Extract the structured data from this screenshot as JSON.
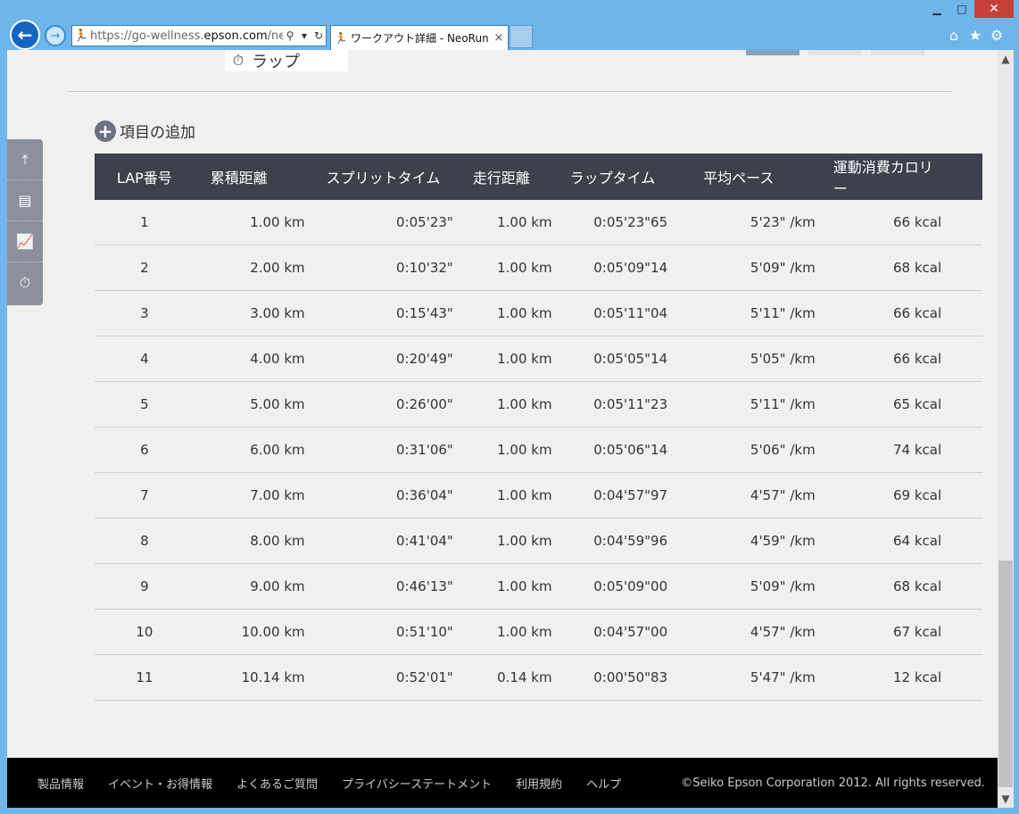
{
  "browser": {
    "url_prefix": "https://go-wellness.",
    "url_domain": "epson.com",
    "url_suffix": "/neo",
    "tab_title": "ワークアウト詳細 - NeoRun",
    "close_glyph": "×"
  },
  "page": {
    "lap_pill_label": "ラップ",
    "add_item_label": "項目の追加"
  },
  "table": {
    "headers": [
      "LAP番号",
      "累積距離",
      "スプリットタイム",
      "走行距離",
      "ラップタイム",
      "平均ペース",
      "運動消費カロリー"
    ],
    "rows": [
      [
        "1",
        "1.00 km",
        "0:05'23\"",
        "1.00 km",
        "0:05'23\"65",
        "5'23\" /km",
        "66 kcal"
      ],
      [
        "2",
        "2.00 km",
        "0:10'32\"",
        "1.00 km",
        "0:05'09\"14",
        "5'09\" /km",
        "68 kcal"
      ],
      [
        "3",
        "3.00 km",
        "0:15'43\"",
        "1.00 km",
        "0:05'11\"04",
        "5'11\" /km",
        "66 kcal"
      ],
      [
        "4",
        "4.00 km",
        "0:20'49\"",
        "1.00 km",
        "0:05'05\"14",
        "5'05\" /km",
        "66 kcal"
      ],
      [
        "5",
        "5.00 km",
        "0:26'00\"",
        "1.00 km",
        "0:05'11\"23",
        "5'11\" /km",
        "65 kcal"
      ],
      [
        "6",
        "6.00 km",
        "0:31'06\"",
        "1.00 km",
        "0:05'06\"14",
        "5'06\" /km",
        "74 kcal"
      ],
      [
        "7",
        "7.00 km",
        "0:36'04\"",
        "1.00 km",
        "0:04'57\"97",
        "4'57\" /km",
        "69 kcal"
      ],
      [
        "8",
        "8.00 km",
        "0:41'04\"",
        "1.00 km",
        "0:04'59\"96",
        "4'59\" /km",
        "64 kcal"
      ],
      [
        "9",
        "9.00 km",
        "0:46'13\"",
        "1.00 km",
        "0:05'09\"00",
        "5'09\" /km",
        "68 kcal"
      ],
      [
        "10",
        "10.00 km",
        "0:51'10\"",
        "1.00 km",
        "0:04'57\"00",
        "4'57\" /km",
        "67 kcal"
      ],
      [
        "11",
        "10.14 km",
        "0:52'01\"",
        "0.14 km",
        "0:00'50\"83",
        "5'47\" /km",
        "12 kcal"
      ]
    ]
  },
  "footer": {
    "links": [
      "製品情報",
      "イベント・お得情報",
      "よくあるご質問",
      "プライバシーステートメント",
      "利用規約",
      "ヘルプ"
    ],
    "copyright": "©Seiko Epson Corporation 2012. All rights reserved."
  },
  "colors": {
    "table_header_bg": "#3c414c",
    "footer_bg": "#000000",
    "chrome_bg": "#6db5ea"
  }
}
